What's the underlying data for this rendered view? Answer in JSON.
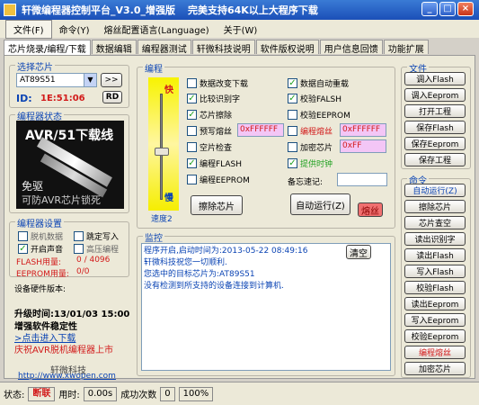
{
  "window": {
    "title": "轩微编程器控制平台_V3.0_增强版",
    "subtitle": "完美支持64K以上大程序下载",
    "min": "_",
    "max": "□",
    "close": "×"
  },
  "menu": [
    "文件(F)",
    "命令(Y)",
    "熔丝配置语言(Language)",
    "关于(W)"
  ],
  "tabs": [
    "芯片烧录/编程/下载",
    "数据编辑",
    "编程器测试",
    "轩微科技说明",
    "软件版权说明",
    "用户信息回馈",
    "功能扩展"
  ],
  "chip_select": {
    "title": "选择芯片",
    "selected": "AT89S51",
    "next_btn": ">>",
    "id_label": "ID:",
    "id_value": "1E:51:06",
    "rd_btn": "RD"
  },
  "programmer_status": {
    "title": "编程器状态",
    "logo": "AVR/51下载线",
    "caption1": "免驱",
    "caption2": "可防AVR芯片锁死"
  },
  "programmer_settings": {
    "title": "编程器设置",
    "offline_data": "脱机数据",
    "auto_write": "跳定写入",
    "sound": "开启声音",
    "high_voltage": "高压编程",
    "flash_label": "FLASH用量:",
    "flash_val": "0 / 4096",
    "eeprom_label": "EEPROM用量:",
    "eeprom_val": "0/0"
  },
  "hw_version": "设备硬件版本:",
  "upgrade": {
    "time": "升级时间:13/01/03 15:00",
    "desc": "增强软件稳定性",
    "link": ">点击进入下载",
    "promo": "庆祝AVR脱机编程器上市"
  },
  "footer": {
    "company": "轩微科技",
    "url": "http://www.xwopen.com"
  },
  "program": {
    "title": "编程",
    "fast": "快",
    "slow": "慢",
    "speed": "速度2",
    "options_left": [
      {
        "label": "数据改变下载",
        "checked": false
      },
      {
        "label": "比较识别字",
        "checked": true
      },
      {
        "label": "芯片擦除",
        "checked": true
      },
      {
        "label": "预写熔丝",
        "checked": false
      },
      {
        "label": "空片检查",
        "checked": false
      },
      {
        "label": "编程FLASH",
        "checked": true
      },
      {
        "label": "编程EEPROM",
        "checked": false
      }
    ],
    "preset_fuse": "0xFFFFFF",
    "options_right": [
      {
        "label": "数据自动重载",
        "checked": true
      },
      {
        "label": "校验FALSH",
        "checked": true
      },
      {
        "label": "校验EEPROM",
        "checked": false
      },
      {
        "label": "编程熔丝",
        "checked": false
      },
      {
        "label": "加密芯片",
        "checked": false
      },
      {
        "label": "提供时钟",
        "checked": true
      }
    ],
    "prog_fuse": "0xFFFFFF",
    "encrypt": "0xFF",
    "memo_label": "备忘速记:",
    "erase_btn": "擦除芯片",
    "auto_btn": "自动运行(Z)",
    "fuse_btn": "熔丝"
  },
  "monitor": {
    "title": "监控",
    "clear": "清空",
    "lines": [
      "程序开启,启动时间为:2013-05-22 08:49:16",
      "轩微科技祝您一切顺利.",
      "您选中的目标芯片为:AT89S51",
      "没有检测到所支持的设备连接到计算机."
    ]
  },
  "file_panel": {
    "title": "文件",
    "buttons": [
      "调入Flash",
      "调入Eeprom",
      "打开工程",
      "保存Flash",
      "保存Eeprom",
      "保存工程"
    ]
  },
  "cmd_panel": {
    "title": "命令",
    "buttons": [
      "自动运行(Z)",
      "擦除芯片",
      "芯片查空",
      "读出识别字",
      "读出Flash",
      "写入Flash",
      "校验Flash",
      "读出Eeprom",
      "写入Eeprom",
      "校验Eeprom",
      "编程熔丝",
      "加密芯片"
    ]
  },
  "status": {
    "state_label": "状态:",
    "state_val": "断联",
    "time_label": "用时:",
    "time_val": "0.00s",
    "success_label": "成功次数",
    "success_val": "0",
    "percent": "100%"
  }
}
